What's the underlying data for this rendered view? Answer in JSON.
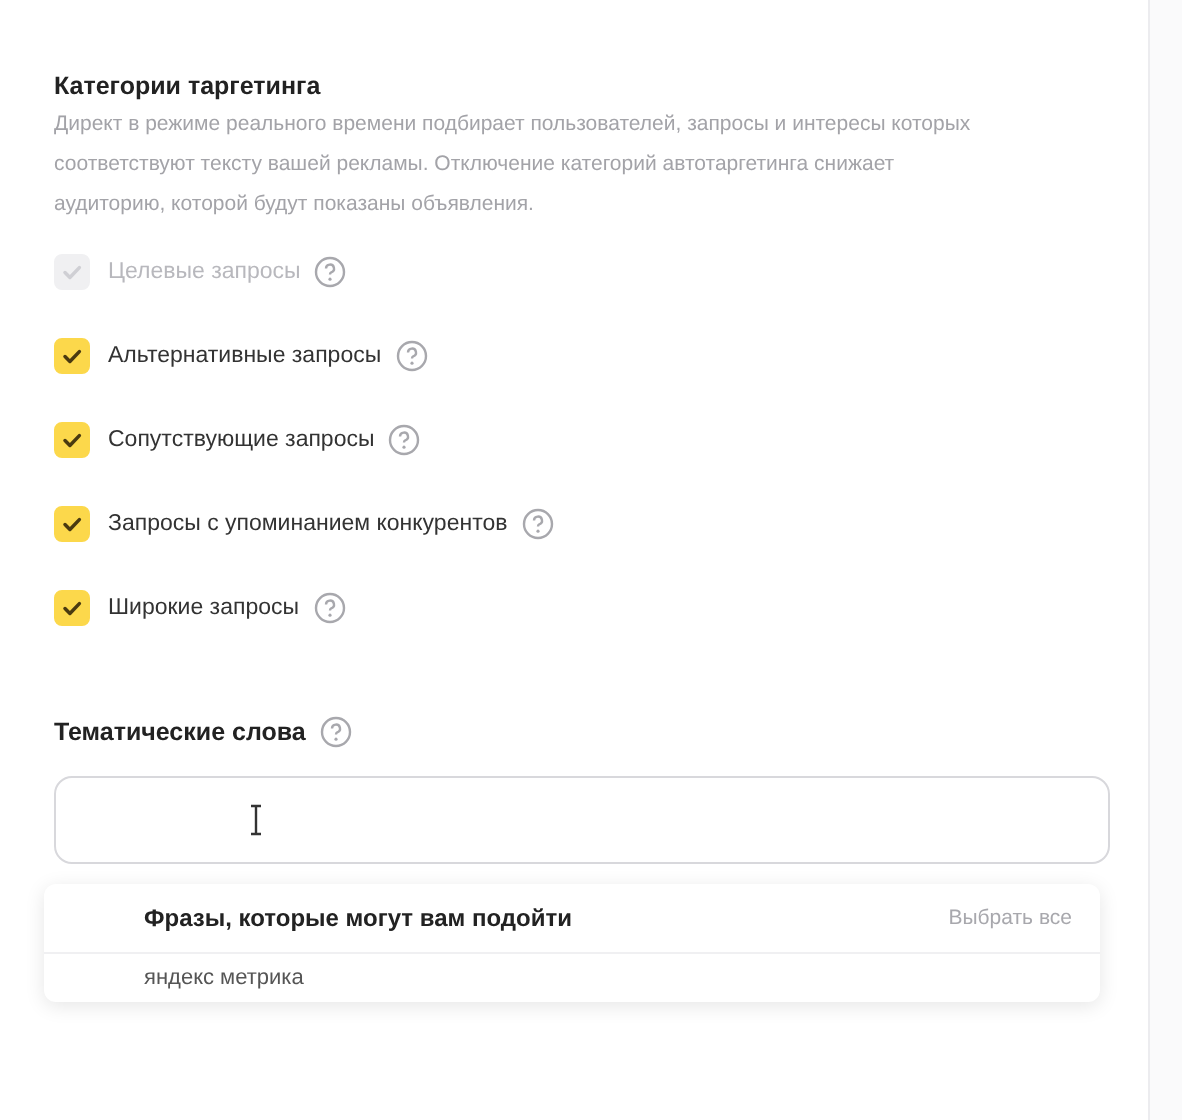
{
  "section": {
    "title": "Категории таргетинга",
    "description": "Директ в режиме реального времени подбирает пользователей, запросы и интересы которых соответствуют тексту вашей рекламы. Отключение категорий автотаргетинга снижает аудиторию, которой будут показаны объявления."
  },
  "categories": [
    {
      "label": "Целевые запросы",
      "checked": true,
      "disabled": true
    },
    {
      "label": "Альтернативные запросы",
      "checked": true,
      "disabled": false
    },
    {
      "label": "Сопутствующие запросы",
      "checked": true,
      "disabled": false
    },
    {
      "label": "Запросы с упоминанием конкурентов",
      "checked": true,
      "disabled": false
    },
    {
      "label": "Широкие запросы",
      "checked": true,
      "disabled": false
    }
  ],
  "keywords": {
    "title": "Тематические слова",
    "suggestions": {
      "title": "Фразы, которые могут вам подойти",
      "select_all": "Выбрать все",
      "items": [
        "яндекс метрика"
      ]
    }
  }
}
